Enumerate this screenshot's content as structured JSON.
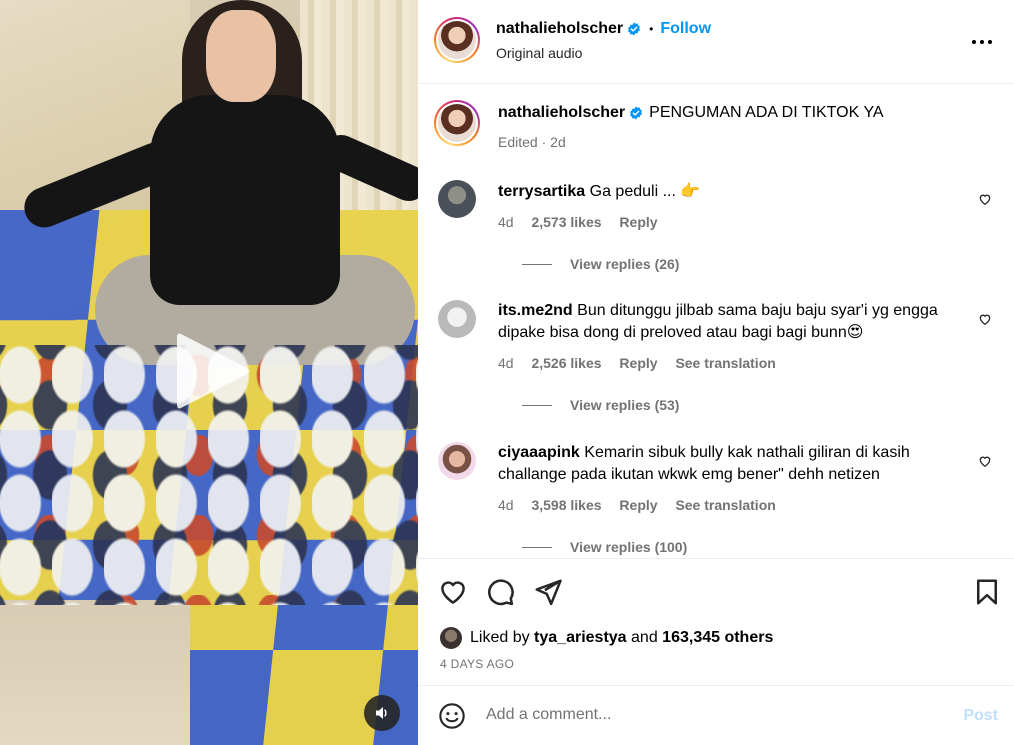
{
  "post": {
    "username": "nathalieholscher",
    "follow_label": "Follow",
    "separator": "•",
    "audio": "Original audio",
    "caption": "PENGUMAN ADA DI TIKTOK YA",
    "edited_label": "Edited",
    "edited_age": "2d"
  },
  "comments": [
    {
      "username": "terrysartika",
      "text": "Ga peduli ...",
      "emoji": "👉",
      "age": "4d",
      "likes": "2,573 likes",
      "reply": "Reply",
      "translation": "",
      "view_replies": "View replies (26)"
    },
    {
      "username": "its.me2nd",
      "text": "Bun ditunggu jilbab sama baju baju syar'i yg engga dipake bisa dong di preloved atau bagi bagi bunn",
      "emoji": "😍",
      "age": "4d",
      "likes": "2,526 likes",
      "reply": "Reply",
      "translation": "See translation",
      "view_replies": "View replies (53)"
    },
    {
      "username": "ciyaaapink",
      "text": "Kemarin sibuk bully kak nathali giliran di kasih challange pada ikutan wkwk emg bener\" dehh netizen",
      "emoji": "",
      "age": "4d",
      "likes": "3,598 likes",
      "reply": "Reply",
      "translation": "See translation",
      "view_replies": "View replies (100)"
    }
  ],
  "likes": {
    "prefix": "Liked by",
    "user": "tya_ariestya",
    "middle": "and",
    "others": "163,345 others",
    "date": "4 DAYS AGO"
  },
  "composer": {
    "placeholder": "Add a comment...",
    "post_label": "Post"
  },
  "icons": [
    "play-icon",
    "volume-icon",
    "verified-badge-icon",
    "more-icon",
    "heart-icon",
    "comment-icon",
    "share-icon",
    "bookmark-icon",
    "emoji-icon"
  ],
  "colors": {
    "link_blue": "#0095f6",
    "verified_blue": "#0095f6",
    "muted_gray": "#737373",
    "post_disabled": "#c0dffd"
  }
}
